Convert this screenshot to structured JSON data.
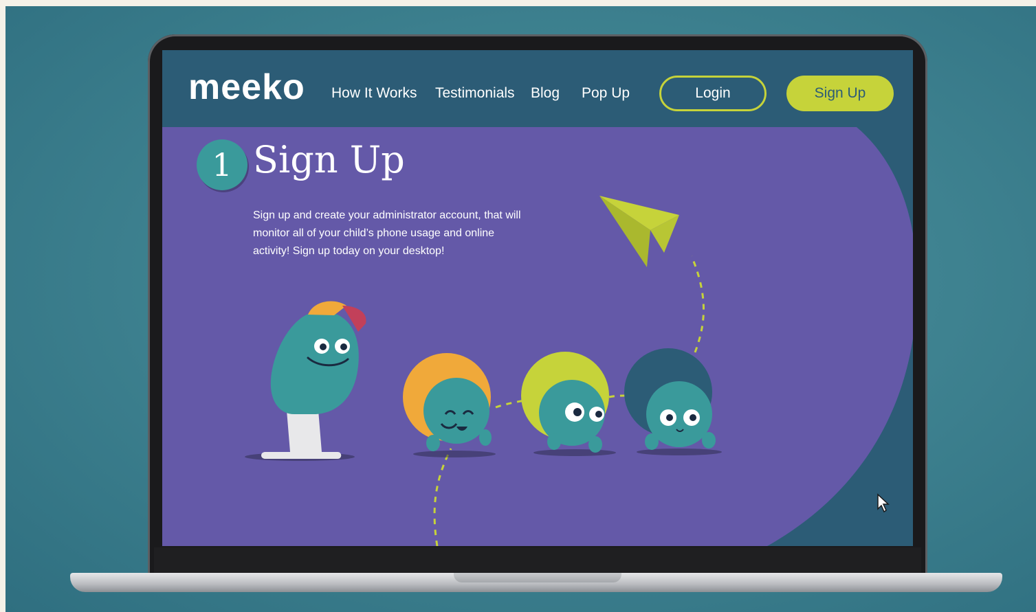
{
  "brand": {
    "logo_text": "meeko"
  },
  "nav": {
    "links": [
      "How It Works",
      "Testimonials",
      "Blog",
      "Pop Up"
    ],
    "login_label": "Login",
    "signup_label": "Sign Up"
  },
  "hero": {
    "step_number": "1",
    "step_title": "Sign Up",
    "step_description": "Sign up and create your administrator account, that will monitor all of your child’s phone usage and online activity! Sign up today on your desktop!"
  },
  "colors": {
    "screen_bg": "#2c5c76",
    "hero_purple": "#6459a8",
    "accent_lime": "#c6d33a",
    "character_teal": "#3a9a9b",
    "orange": "#f0a93a"
  }
}
